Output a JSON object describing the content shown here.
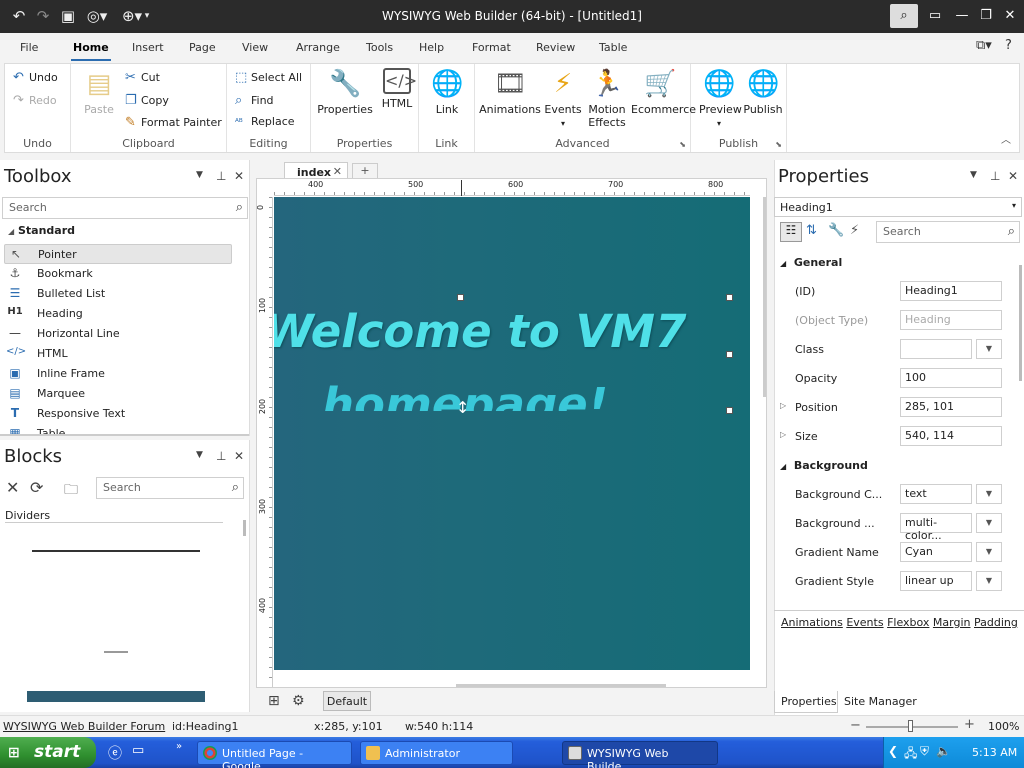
{
  "window": {
    "title": "WYSIWYG Web Builder (64-bit) - [Untitled1]"
  },
  "menu": {
    "tabs": [
      "File",
      "Home",
      "Insert",
      "Page",
      "View",
      "Arrange",
      "Tools",
      "Help",
      "Format",
      "Review",
      "Table"
    ],
    "active": "Home"
  },
  "ribbon": {
    "undo": {
      "undo": "Undo",
      "redo": "Redo",
      "label": "Undo"
    },
    "clipboard": {
      "paste": "Paste",
      "cut": "Cut",
      "copy": "Copy",
      "format_painter": "Format Painter",
      "label": "Clipboard"
    },
    "editing": {
      "select_all": "Select All",
      "find": "Find",
      "replace": "Replace",
      "label": "Editing"
    },
    "properties": {
      "properties": "Properties",
      "html": "HTML",
      "label": "Properties"
    },
    "link": {
      "link": "Link",
      "label": "Link"
    },
    "advanced": {
      "animations": "Animations",
      "events": "Events",
      "motion_effects_1": "Motion",
      "motion_effects_2": "Effects",
      "ecommerce": "Ecommerce",
      "label": "Advanced"
    },
    "publish": {
      "preview": "Preview",
      "publish": "Publish",
      "label": "Publish"
    }
  },
  "toolbox": {
    "title": "Toolbox",
    "search_placeholder": "Search",
    "section": "Standard",
    "items": [
      {
        "label": "Pointer",
        "icon": "pointer-icon"
      },
      {
        "label": "Bookmark",
        "icon": "anchor-icon"
      },
      {
        "label": "Bulleted List",
        "icon": "list-icon"
      },
      {
        "label": "Heading",
        "icon": "heading-icon"
      },
      {
        "label": "Horizontal Line",
        "icon": "line-icon"
      },
      {
        "label": "HTML",
        "icon": "code-icon"
      },
      {
        "label": "Inline Frame",
        "icon": "frame-icon"
      },
      {
        "label": "Marquee",
        "icon": "marquee-icon"
      },
      {
        "label": "Responsive Text",
        "icon": "text-icon"
      },
      {
        "label": "Table",
        "icon": "table-icon"
      }
    ]
  },
  "blocks": {
    "title": "Blocks",
    "search_placeholder": "Search",
    "section": "Dividers"
  },
  "document": {
    "tabs": [
      "index",
      "+"
    ],
    "ruler_top": [
      "400",
      "500",
      "600",
      "700",
      "800"
    ],
    "ruler_left": [
      "0",
      "100",
      "200",
      "300",
      "400"
    ],
    "heading_line1": "Welcome to VM7",
    "heading_line2": "homepage!",
    "bottom_button": "Default"
  },
  "properties": {
    "title": "Properties",
    "selected_object": "Heading1",
    "search_placeholder": "Search",
    "sections": {
      "general": "General",
      "background": "Background"
    },
    "rows": {
      "id": {
        "label": "(ID)",
        "value": "Heading1"
      },
      "object_type": {
        "label": "(Object Type)",
        "value": "Heading"
      },
      "class": {
        "label": "Class",
        "value": ""
      },
      "opacity": {
        "label": "Opacity",
        "value": "100"
      },
      "position": {
        "label": "Position",
        "value": "285, 101"
      },
      "size": {
        "label": "Size",
        "value": "540, 114"
      },
      "bg_color": {
        "label": "Background C...",
        "value": "text"
      },
      "bg": {
        "label": "Background ...",
        "value": "multi-color..."
      },
      "gradient_name": {
        "label": "Gradient Name",
        "value": "Cyan"
      },
      "gradient_style": {
        "label": "Gradient Style",
        "value": "linear up"
      }
    },
    "links": [
      "Animations",
      "Events",
      "Flexbox",
      "Margin",
      "Padding"
    ],
    "bottom_tabs": [
      "Properties",
      "Site Manager"
    ]
  },
  "status": {
    "forum": "WYSIWYG Web Builder Forum",
    "id": "id:Heading1",
    "xy": "x:285, y:101",
    "wh": "w:540 h:114",
    "zoom": "100%"
  },
  "taskbar": {
    "start": "start",
    "tasks": [
      "Untitled Page - Google...",
      "Administrator",
      "WYSIWYG Web Builde..."
    ],
    "clock": "5:13 AM"
  },
  "colors": {
    "accent": "#2b6cb0",
    "canvas_bg": "#1e6a7a",
    "heading_text": "#4fe0e8"
  }
}
